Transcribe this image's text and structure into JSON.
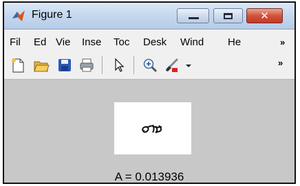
{
  "window": {
    "title": "Figure 1"
  },
  "menu": {
    "items": [
      "Fil",
      "Ed",
      "Vie",
      "Inse",
      "Toc",
      "Desk",
      "Wind",
      "He"
    ],
    "overflow_icon": "double-chevron-icon"
  },
  "toolbar": {
    "icons": [
      "new-file-icon",
      "open-folder-icon",
      "save-icon",
      "print-icon",
      "select-arrow-icon",
      "zoom-in-icon",
      "brush-icon",
      "dropdown-arrow-icon"
    ],
    "overflow_icon": "double-chevron-icon"
  },
  "figure": {
    "caption": "A = 0.013936"
  },
  "colors": {
    "figure_background": "#c8c8c8",
    "titlebar": "#c2d6ee",
    "close_button": "#d1533a",
    "plot_background": "#ffffff"
  }
}
